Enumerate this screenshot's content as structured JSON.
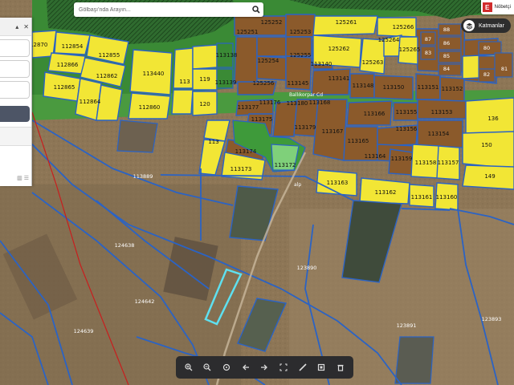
{
  "search": {
    "placeholder": "Gölbaşı'nda Arayın..."
  },
  "nobetci": {
    "badge": "E",
    "label": "Nöbetçi"
  },
  "layers": {
    "label": "Katmanlar"
  },
  "parcels": {
    "p112870": "112870",
    "p112854": "112854",
    "p112855": "112855",
    "p112866": "112866",
    "p112862": "112862",
    "p112865": "112865",
    "p112864": "112864",
    "p112860": "112860",
    "p113440": "113440",
    "p113138": "113138",
    "p119": "119",
    "p113": "113",
    "p120": "120",
    "p113139": "113139",
    "p125251": "125251",
    "p125252": "125252",
    "p125253": "125253",
    "p125254": "125254",
    "p125255": "125255",
    "p125256": "125256",
    "p125261": "125261",
    "p125262": "125262",
    "p125263": "125263",
    "p125264": "125264",
    "p125265": "125265",
    "p125266": "125266",
    "p113140": "113140",
    "p113141": "113141",
    "p113145": "113145",
    "p113148": "113148",
    "p113150": "113150",
    "p113151": "113151",
    "p113152": "113152",
    "p113177": "113177",
    "p113176": "113176",
    "p113180": "113180",
    "p113168": "113168",
    "p113175": "113175",
    "p113179": "113179",
    "p113167": "113167",
    "p113166": "113166",
    "p113155": "113155",
    "p113153": "113153",
    "p113156": "113156",
    "p113154": "113154",
    "p113165": "113165",
    "p113164": "113164",
    "p113174": "113174",
    "p113173": "113173",
    "p113172": "113172",
    "p113159": "113159",
    "p113158": "113158",
    "p113157": "113157",
    "p113163": "113163",
    "p113162": "113162",
    "p113161": "113161",
    "p113160": "113160",
    "p136": "136",
    "p150": "150",
    "p149": "149",
    "p88": "88",
    "p87": "87",
    "p86": "86",
    "p85": "85",
    "p84": "84",
    "p83": "83",
    "p82": "82",
    "p80": "80",
    "p81": "81",
    "p113889": "113889",
    "p124638": "124638",
    "p124642": "124642",
    "p124639": "124639",
    "p123890": "123890",
    "p123891": "123891",
    "p123893": "123893"
  },
  "roads": {
    "r1": "Ballıkorpar Cd",
    "r2": "alp"
  },
  "toolbar": {
    "icons": [
      "zoom-in",
      "zoom-out",
      "zoom-extent",
      "back",
      "forward",
      "fullscreen",
      "measure",
      "print",
      "delete"
    ]
  },
  "colors": {
    "residential": "#f2e635",
    "built": "#8b5a2b",
    "green": "#3e8f3a",
    "parcel_border": "#2b63c4",
    "selected": "#5ee0f0"
  }
}
